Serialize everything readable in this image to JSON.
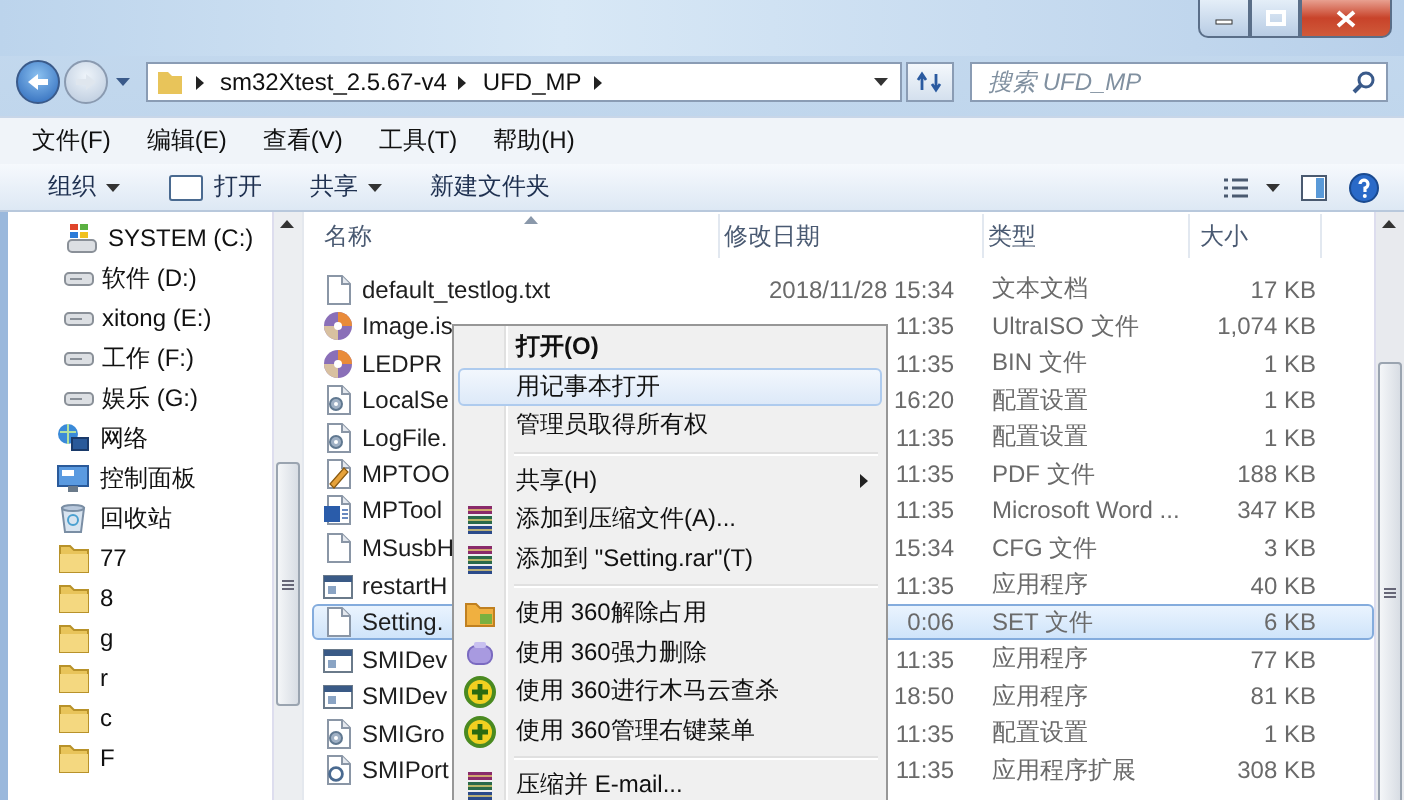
{
  "address": {
    "path": [
      "sm32Xtest_2.5.67-v4",
      "UFD_MP"
    ]
  },
  "search": {
    "placeholder": "搜索 UFD_MP"
  },
  "menu_bar": [
    "文件(F)",
    "编辑(E)",
    "查看(V)",
    "工具(T)",
    "帮助(H)"
  ],
  "toolbar": [
    {
      "label": "组织",
      "kind": "plain",
      "dropdown": true
    },
    {
      "label": "打开",
      "kind": "open",
      "dropdown": false
    },
    {
      "label": "共享",
      "kind": "plain",
      "dropdown": true
    },
    {
      "label": "新建文件夹",
      "kind": "plain",
      "dropdown": false
    }
  ],
  "nav": [
    {
      "label": "SYSTEM (C:)",
      "kind": "system-drive"
    },
    {
      "label": "软件 (D:)",
      "kind": "drive"
    },
    {
      "label": "xitong (E:)",
      "kind": "drive"
    },
    {
      "label": "工作 (F:)",
      "kind": "drive"
    },
    {
      "label": "娱乐 (G:)",
      "kind": "drive"
    },
    {
      "label": "网络",
      "kind": "network"
    },
    {
      "label": "控制面板",
      "kind": "control-panel"
    },
    {
      "label": "回收站",
      "kind": "recycle-bin"
    },
    {
      "label": "77",
      "kind": "folder"
    },
    {
      "label": "8",
      "kind": "folder"
    },
    {
      "label": "g",
      "kind": "folder"
    },
    {
      "label": "r",
      "kind": "folder"
    },
    {
      "label": "c",
      "kind": "folder"
    },
    {
      "label": "F",
      "kind": "folder"
    }
  ],
  "columns": [
    "名称",
    "修改日期",
    "类型",
    "大小"
  ],
  "files": [
    {
      "name": "default_testlog.txt",
      "modified": "2018/11/28 15:34",
      "type": "文本文档",
      "size": "17 KB",
      "kind": "text",
      "selected": false
    },
    {
      "name": "Image.is",
      "modified": "11:35",
      "type": "UltraISO 文件",
      "size": "1,074 KB",
      "kind": "disc",
      "selected": false
    },
    {
      "name": "LEDPR",
      "modified": "11:35",
      "type": "BIN 文件",
      "size": "1 KB",
      "kind": "disc",
      "selected": false
    },
    {
      "name": "LocalSe",
      "modified": "16:20",
      "type": "配置设置",
      "size": "1 KB",
      "kind": "settings",
      "selected": false
    },
    {
      "name": "LogFile.",
      "modified": "11:35",
      "type": "配置设置",
      "size": "1 KB",
      "kind": "settings",
      "selected": false
    },
    {
      "name": "MPTOO",
      "modified": "11:35",
      "type": "PDF 文件",
      "size": "188 KB",
      "kind": "pdf",
      "selected": false
    },
    {
      "name": "MPTool",
      "modified": "11:35",
      "type": "Microsoft Word ...",
      "size": "347 KB",
      "kind": "word",
      "selected": false
    },
    {
      "name": "MSusbH",
      "modified": "15:34",
      "type": "CFG 文件",
      "size": "3 KB",
      "kind": "text",
      "selected": false
    },
    {
      "name": "restartH",
      "modified": "11:35",
      "type": "应用程序",
      "size": "40 KB",
      "kind": "app",
      "selected": false
    },
    {
      "name": "Setting.",
      "modified": "0:06",
      "type": "SET 文件",
      "size": "6 KB",
      "kind": "text",
      "selected": true
    },
    {
      "name": "SMIDev",
      "modified": "11:35",
      "type": "应用程序",
      "size": "77 KB",
      "kind": "app",
      "selected": false
    },
    {
      "name": "SMIDev",
      "modified": "18:50",
      "type": "应用程序",
      "size": "81 KB",
      "kind": "app",
      "selected": false
    },
    {
      "name": "SMIGro",
      "modified": "11:35",
      "type": "配置设置",
      "size": "1 KB",
      "kind": "settings",
      "selected": false
    },
    {
      "name": "SMIPort",
      "modified": "11:35",
      "type": "应用程序扩展",
      "size": "308 KB",
      "kind": "extension",
      "selected": false
    }
  ],
  "context_menu": [
    {
      "kind": "plain",
      "label": "打开(O)",
      "default": true,
      "selected": false,
      "submenu": false
    },
    {
      "kind": "plain",
      "label": "用记事本打开",
      "default": false,
      "selected": true,
      "submenu": false
    },
    {
      "kind": "plain",
      "label": "管理员取得所有权",
      "default": false,
      "selected": false,
      "submenu": false
    },
    {
      "kind": "separator"
    },
    {
      "kind": "plain",
      "label": "共享(H)",
      "default": false,
      "selected": false,
      "submenu": true
    },
    {
      "kind": "archive",
      "label": "添加到压缩文件(A)...",
      "default": false,
      "selected": false,
      "submenu": false
    },
    {
      "kind": "archive",
      "label": "添加到 \"Setting.rar\"(T)",
      "default": false,
      "selected": false,
      "submenu": false
    },
    {
      "kind": "separator"
    },
    {
      "kind": "unlock",
      "label": "使用 360解除占用",
      "default": false,
      "selected": false,
      "submenu": false
    },
    {
      "kind": "erase",
      "label": "使用 360强力删除",
      "default": false,
      "selected": false,
      "submenu": false
    },
    {
      "kind": "scan",
      "label": "使用 360进行木马云查杀",
      "default": false,
      "selected": false,
      "submenu": false
    },
    {
      "kind": "scan",
      "label": "使用 360管理右键菜单",
      "default": false,
      "selected": false,
      "submenu": false
    },
    {
      "kind": "separator"
    },
    {
      "kind": "archive",
      "label": "压缩并 E-mail...",
      "default": false,
      "selected": false,
      "submenu": false
    }
  ]
}
